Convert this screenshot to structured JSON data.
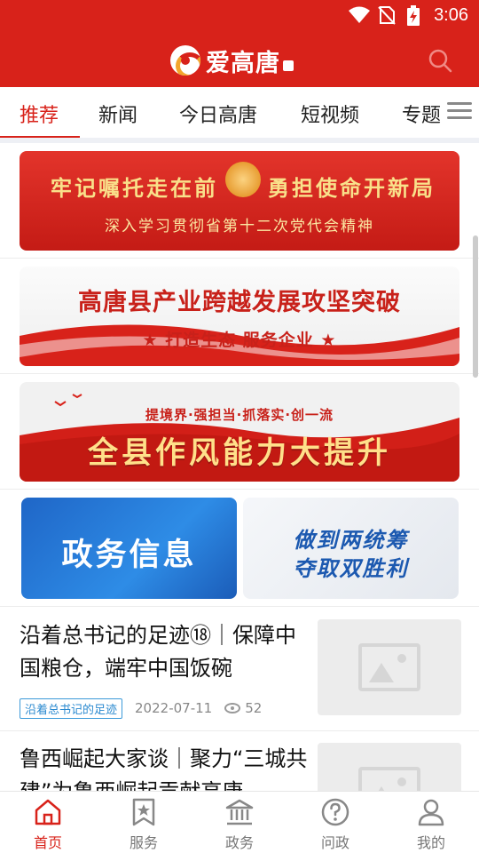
{
  "status_bar": {
    "time": "3:06"
  },
  "header": {
    "app_name": "爱高唐"
  },
  "tabs": [
    {
      "label": "推荐",
      "active": true
    },
    {
      "label": "新闻",
      "active": false
    },
    {
      "label": "今日高唐",
      "active": false
    },
    {
      "label": "短视频",
      "active": false
    },
    {
      "label": "专题",
      "active": false
    }
  ],
  "banners": [
    {
      "line1_left": "牢记嘱托走在前",
      "line1_right": "勇担使命开新局",
      "line2": "深入学习贯彻省第十二次党代会精神"
    },
    {
      "title": "高唐县产业跨越发展攻坚突破",
      "subtitle": "★ 打造生态 服务企业 ★"
    },
    {
      "top": "提境界·强担当·抓落实·创一流",
      "title": "全县作风能力大提升"
    }
  ],
  "cards": [
    {
      "text": "政务信息"
    },
    {
      "line1": "做到两统筹",
      "line2": "夺取双胜利"
    }
  ],
  "news": [
    {
      "title": "沿着总书记的足迹⑱｜保障中国粮仓，端牢中国饭碗",
      "tag": "沿着总书记的足迹",
      "date": "2022-07-11",
      "views": "52"
    },
    {
      "title": "鲁西崛起大家谈｜聚力“三城共建”为鲁西崛起贡献高唐"
    }
  ],
  "bottom_nav": [
    {
      "label": "首页",
      "icon": "home-icon",
      "active": true
    },
    {
      "label": "服务",
      "icon": "bookmark-star-icon",
      "active": false
    },
    {
      "label": "政务",
      "icon": "government-building-icon",
      "active": false
    },
    {
      "label": "问政",
      "icon": "question-icon",
      "active": false
    },
    {
      "label": "我的",
      "icon": "user-icon",
      "active": false
    }
  ],
  "colors": {
    "brand": "#d8221a",
    "tag_blue": "#2b8ad0"
  }
}
